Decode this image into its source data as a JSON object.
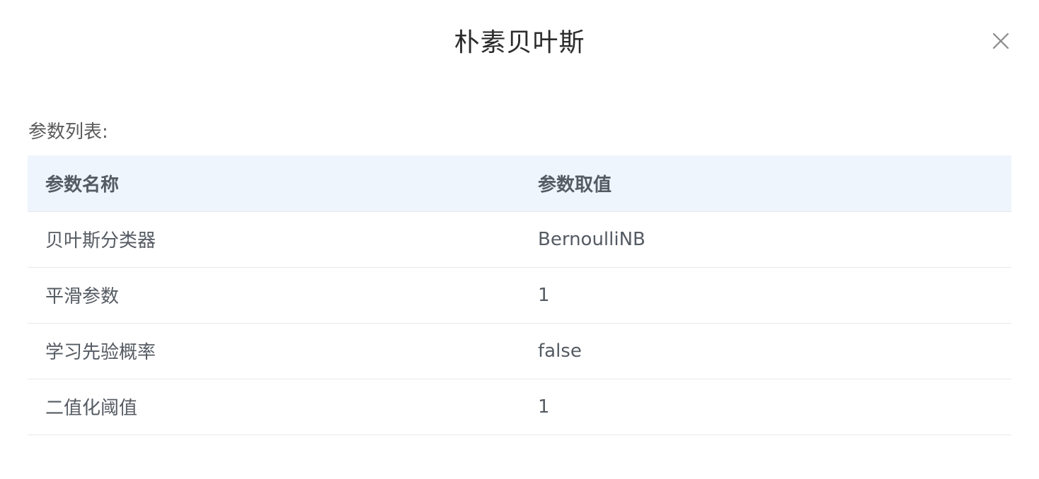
{
  "dialog": {
    "title": "朴素贝叶斯",
    "close_icon": "close-icon"
  },
  "section": {
    "label": "参数列表:"
  },
  "table": {
    "headers": [
      "参数名称",
      "参数取值"
    ],
    "rows": [
      {
        "name": "贝叶斯分类器",
        "value": "BernoulliNB"
      },
      {
        "name": "平滑参数",
        "value": "1"
      },
      {
        "name": "学习先验概率",
        "value": "false"
      },
      {
        "name": "二值化阈值",
        "value": "1"
      }
    ]
  },
  "colors": {
    "header_bg": "#eef5fd",
    "border": "#e6e8eb",
    "text": "#555b63"
  }
}
